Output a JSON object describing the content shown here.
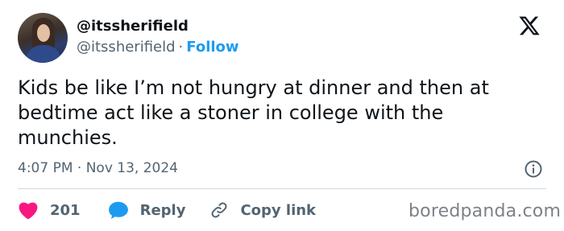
{
  "author": {
    "display_name": "@itssherifield",
    "handle": "@itssherifield",
    "separator": "·",
    "follow_label": "Follow"
  },
  "tweet": {
    "text": "Kids be like I’m not hungry at dinner and then at bedtime act like a stoner in college with the munchies.",
    "timestamp": "4:07 PM · Nov 13, 2024"
  },
  "actions": {
    "like_count": "201",
    "reply_label": "Reply",
    "copy_link_label": "Copy link"
  },
  "watermark": "boredpanda.com",
  "icons": {
    "logo": "x-logo-icon",
    "info": "info-icon",
    "like": "heart-icon",
    "reply": "speech-bubble-icon",
    "copy": "link-icon"
  },
  "colors": {
    "text": "#0f1419",
    "secondary": "#536471",
    "follow": "#1d9bf0",
    "like": "#f91880",
    "reply": "#1d9bf0",
    "divider": "#cfd9de"
  }
}
